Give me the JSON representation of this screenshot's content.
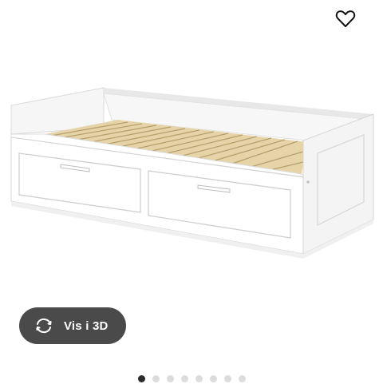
{
  "favorite": {
    "icon": "heart-outline-icon"
  },
  "view3d": {
    "label": "Vis i 3D",
    "icon": "rotate-3d-icon"
  },
  "carousel": {
    "count": 8,
    "active_index": 0
  },
  "product_image": {
    "alt": "bed-with-drawers"
  }
}
